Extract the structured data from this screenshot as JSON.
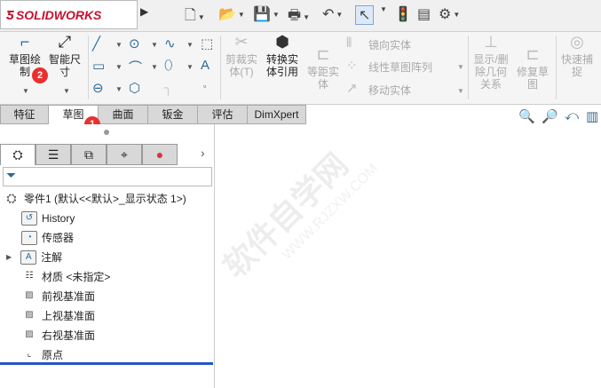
{
  "app": {
    "logo": "SOLIDWORKS",
    "logo_mark": "DS"
  },
  "quick_access": [
    {
      "icon": "new-icon"
    },
    {
      "icon": "open-icon"
    },
    {
      "icon": "save-icon"
    },
    {
      "icon": "print-icon"
    },
    {
      "icon": "undo-icon"
    },
    {
      "icon": "select-icon"
    },
    {
      "icon": "rebuild-icon"
    },
    {
      "icon": "file-properties-icon"
    },
    {
      "icon": "options-icon"
    }
  ],
  "ribbon": {
    "sketch": "草图绘制",
    "smart_dim": "智能尺寸",
    "trim": "剪裁实体(T)",
    "convert": "转换实体引用",
    "offset": "等距实体",
    "mirror": "镜向实体",
    "linear_pattern": "线性草图阵列",
    "move": "移动实体",
    "relations": "显示/删除几何关系",
    "repair": "修复草图",
    "quick_snap": "快速捕捉"
  },
  "badges": {
    "one": "1",
    "two": "2"
  },
  "tabs": [
    {
      "label": "特征"
    },
    {
      "label": "草图"
    },
    {
      "label": "曲面"
    },
    {
      "label": "钣金"
    },
    {
      "label": "评估"
    },
    {
      "label": "DimXpert"
    }
  ],
  "tree": {
    "root": "零件1  (默认<<默认>_显示状态 1>)",
    "items": [
      {
        "label": "History"
      },
      {
        "label": "传感器"
      },
      {
        "label": "注解"
      },
      {
        "label": "材质 <未指定>"
      },
      {
        "label": "前视基准面"
      },
      {
        "label": "上视基准面"
      },
      {
        "label": "右视基准面"
      },
      {
        "label": "原点"
      }
    ]
  },
  "watermark": {
    "text": "软件自学网",
    "url": "WWW.RJZXW.COM"
  }
}
